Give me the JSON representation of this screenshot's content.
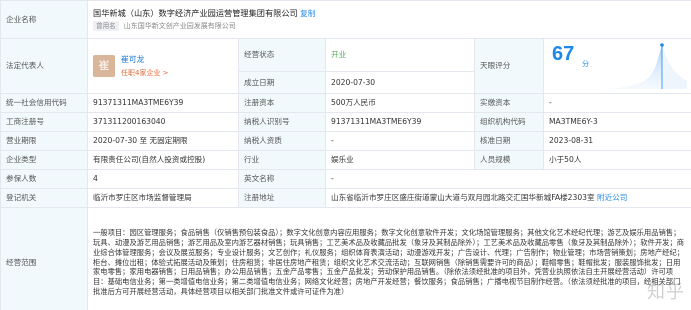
{
  "company": {
    "label": "企业名称",
    "name": "国华新城（山东）数字经济产业园运营管理集团有限公司",
    "copy": "复制",
    "used_tag": "曾用名",
    "used_name": "山东国华新文创产业园发展有限公司"
  },
  "legal": {
    "label": "法定代表人",
    "avatar_char": "崔",
    "name": "崔可龙",
    "role": "任职4家企业 >"
  },
  "status": {
    "label": "经营状态",
    "value": "开业"
  },
  "found": {
    "label": "成立日期",
    "value": "2020-07-30"
  },
  "rating": {
    "label": "天眼评分",
    "score": "67",
    "unit": "分",
    "score_value": 67
  },
  "ucc": {
    "label": "统一社会信用代码",
    "value": "91371311MA3TME6Y39"
  },
  "reg_capital": {
    "label": "注册资本",
    "value": "500万人民币"
  },
  "paid_capital": {
    "label": "实缴资本",
    "value": "-"
  },
  "reg_no": {
    "label": "工商注册号",
    "value": "371311200163040"
  },
  "taxpayer_id": {
    "label": "纳税人识别号",
    "value": "91371311MA3TME6Y39"
  },
  "org_code": {
    "label": "组织机构代码",
    "value": "MA3TME6Y-3"
  },
  "term": {
    "label": "营业期限",
    "value": "2020-07-30 至 无固定期限"
  },
  "taxpayer_qual": {
    "label": "纳税人资质",
    "value": "-"
  },
  "approval": {
    "label": "核准日期",
    "value": "2023-08-31"
  },
  "type": {
    "label": "企业类型",
    "value": "有限责任公司(自然人投资或控股)"
  },
  "industry": {
    "label": "行业",
    "value": "娱乐业"
  },
  "scale": {
    "label": "人员规模",
    "value": "小于50人"
  },
  "insured": {
    "label": "参保人数",
    "value": "4"
  },
  "en_name": {
    "label": "英文名称",
    "value": "-"
  },
  "authority": {
    "label": "登记机关",
    "value": "临沂市罗庄区市场监督管理局"
  },
  "address": {
    "label": "注册地址",
    "value": "山东省临沂市罗庄区盛庄街道蒙山大道与双月园北路交汇国华新城FA楼2303室",
    "link": "附近公司"
  },
  "scope": {
    "label": "经营范围",
    "value": "一般项目：园区管理服务；食品销售（仅销售预包装食品）；数字文化创意内容应用服务；数字文化创意软件开发；文化场馆管理服务；其他文化艺术经纪代理；游艺及娱乐用品销售；玩具、动漫及游艺用品销售；游艺用品及室内游艺器材销售；玩具销售；工艺美术品及收藏品批发（象牙及其制品除外）；工艺美术品及收藏品零售（象牙及其制品除外）；软件开发；商业综合体管理服务；会议及展览服务；专业设计服务；文艺创作；礼仪服务；组织体育表演活动；动漫游戏开发；广告设计、代理；广告制作；物业管理；市场营销策划；房地产经纪；柜台、摊位出租；体验式拓展活动及策划；住房租赁；非居住房地产租赁；组织文化艺术交流活动；互联网销售（除销售需要许可的商品）；鞋帽零售；鞋帽批发；服装服饰批发；日用家电零售；家用电器销售；日用品销售；办公用品销售；五金产品零售；五金产品批发；劳动保护用品销售。（除依法须经批准的项目外，凭营业执照依法自主开展经营活动）许可项目：基础电信业务；第一类增值电信业务；第二类增值电信业务；网络文化经营；房地产开发经营；餐饮服务；食品销售；广播电视节目制作经营。（依法须经批准的项目，经相关部门批准后方可开展经营活动，具体经营项目以相关部门批准文件或许可证件为准）"
  },
  "watermark": "知乎",
  "colors": {
    "accent": "#1e88e5",
    "label_bg": "#f2f9fc",
    "status_green": "#4caf50",
    "role_orange": "#e2693a"
  }
}
